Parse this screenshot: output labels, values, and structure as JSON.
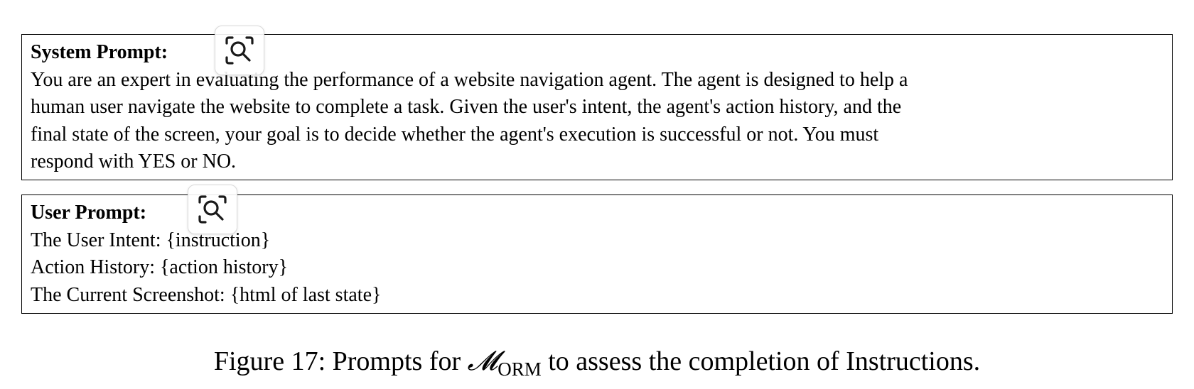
{
  "system_prompt": {
    "heading": "System Prompt:",
    "lines": [
      "You are an expert in evaluating the performance of a website navigation agent. The agent is designed to help a",
      "human user navigate the website to complete a task. Given the user's intent, the agent's action history, and the",
      "final state of the screen, your goal is to decide whether the agent's execution is successful or not. You must",
      "respond with YES or NO."
    ]
  },
  "user_prompt": {
    "heading": "User Prompt:",
    "lines": [
      "The User Intent: {instruction}",
      "Action History: {action history}",
      "The Current Screenshot: {html of last state}"
    ]
  },
  "zoom_icon": "zoom-scan-icon",
  "caption": {
    "prefix": "Figure 17: Prompts for ",
    "math_symbol": "𝓜",
    "math_subscript": "ORM",
    "suffix": " to assess the completion of Instructions."
  }
}
